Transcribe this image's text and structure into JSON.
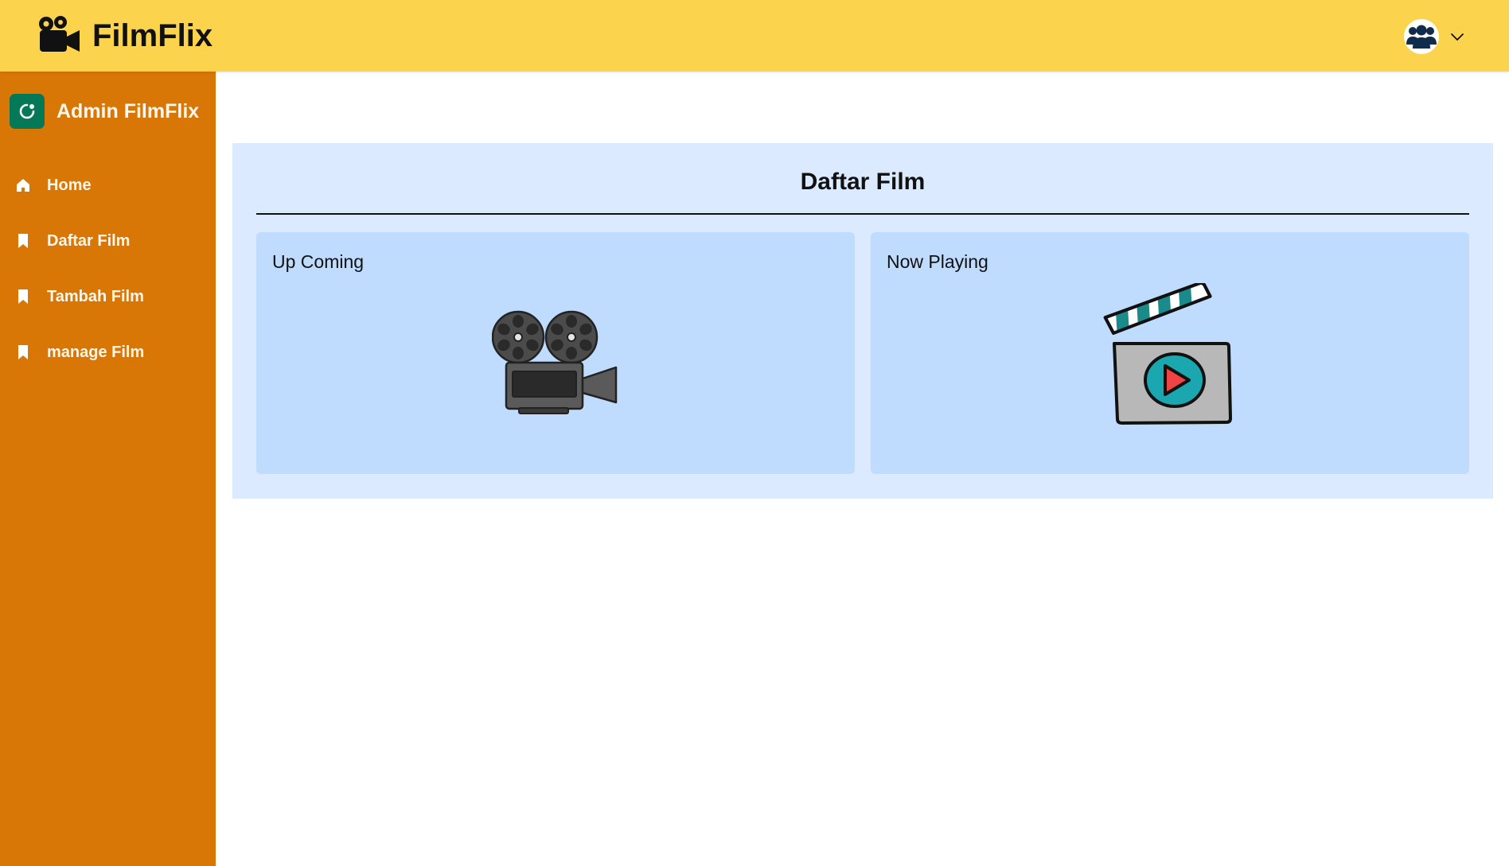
{
  "header": {
    "brand": "FilmFlix",
    "brand_icon": "movie-camera-icon",
    "user_icon": "users-icon",
    "menu_icon": "chevron-down-icon"
  },
  "sidebar": {
    "title": "Admin FilmFlix",
    "logo_icon": "app-logo-icon",
    "items": [
      {
        "label": "Home",
        "icon": "home-icon"
      },
      {
        "label": "Daftar Film",
        "icon": "bookmark-icon"
      },
      {
        "label": "Tambah Film",
        "icon": "bookmark-icon"
      },
      {
        "label": "manage Film",
        "icon": "bookmark-icon"
      }
    ]
  },
  "main": {
    "title": "Daftar Film",
    "cards": [
      {
        "label": "Up Coming",
        "icon": "film-projector-icon"
      },
      {
        "label": "Now Playing",
        "icon": "clapperboard-play-icon"
      }
    ]
  },
  "colors": {
    "topbar": "#fcd34d",
    "sidebar": "#d97706",
    "logo": "#047857",
    "panel": "#dbeafe",
    "card": "#bfdbfe"
  }
}
